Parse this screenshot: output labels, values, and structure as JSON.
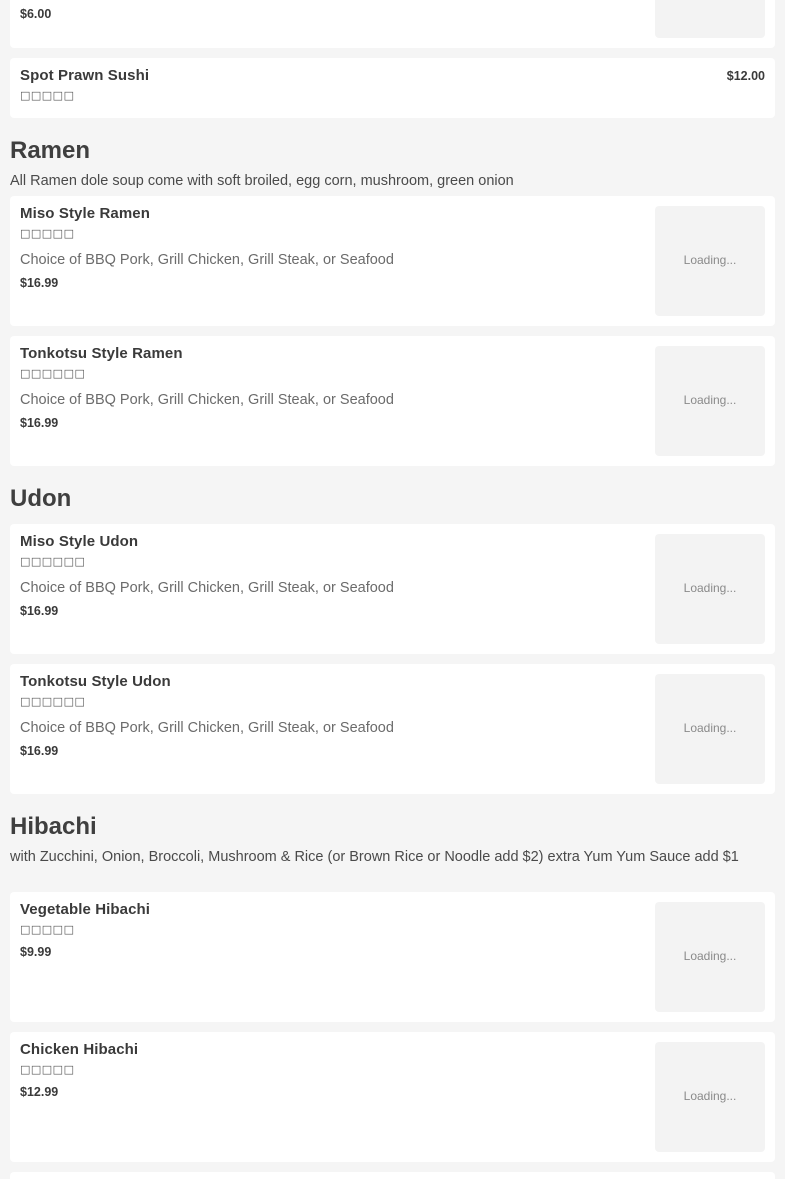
{
  "top_item": {
    "price": "$6.00"
  },
  "spot_prawn": {
    "name": "Spot Prawn Sushi",
    "glyphs": "□□□□□",
    "price": "$12.00"
  },
  "ramen": {
    "title": "Ramen",
    "description": "All Ramen dole soup come with soft broiled, egg corn, mushroom, green onion",
    "items": [
      {
        "name": "Miso Style Ramen",
        "glyphs": "□□□□□",
        "description": "Choice of BBQ Pork, Grill Chicken, Grill Steak, or Seafood",
        "price": "$16.99",
        "image_status": "Loading..."
      },
      {
        "name": "Tonkotsu Style Ramen",
        "glyphs": "□□□□□□",
        "description": "Choice of BBQ Pork, Grill Chicken, Grill Steak, or Seafood",
        "price": "$16.99",
        "image_status": "Loading..."
      }
    ]
  },
  "udon": {
    "title": "Udon",
    "items": [
      {
        "name": "Miso Style Udon",
        "glyphs": "□□□□□□",
        "description": "Choice of BBQ Pork, Grill Chicken, Grill Steak, or Seafood",
        "price": "$16.99",
        "image_status": "Loading..."
      },
      {
        "name": "Tonkotsu Style Udon",
        "glyphs": "□□□□□□",
        "description": "Choice of BBQ Pork, Grill Chicken, Grill Steak, or Seafood",
        "price": "$16.99",
        "image_status": "Loading..."
      }
    ]
  },
  "hibachi": {
    "title": "Hibachi",
    "description": "with Zucchini, Onion, Broccoli, Mushroom & Rice (or Brown Rice or Noodle add $2) extra Yum Yum Sauce add $1",
    "items": [
      {
        "name": "Vegetable Hibachi",
        "glyphs": "□□□□□",
        "price": "$9.99",
        "image_status": "Loading..."
      },
      {
        "name": "Chicken Hibachi",
        "glyphs": "□□□□□",
        "price": "$12.99",
        "image_status": "Loading..."
      }
    ]
  }
}
